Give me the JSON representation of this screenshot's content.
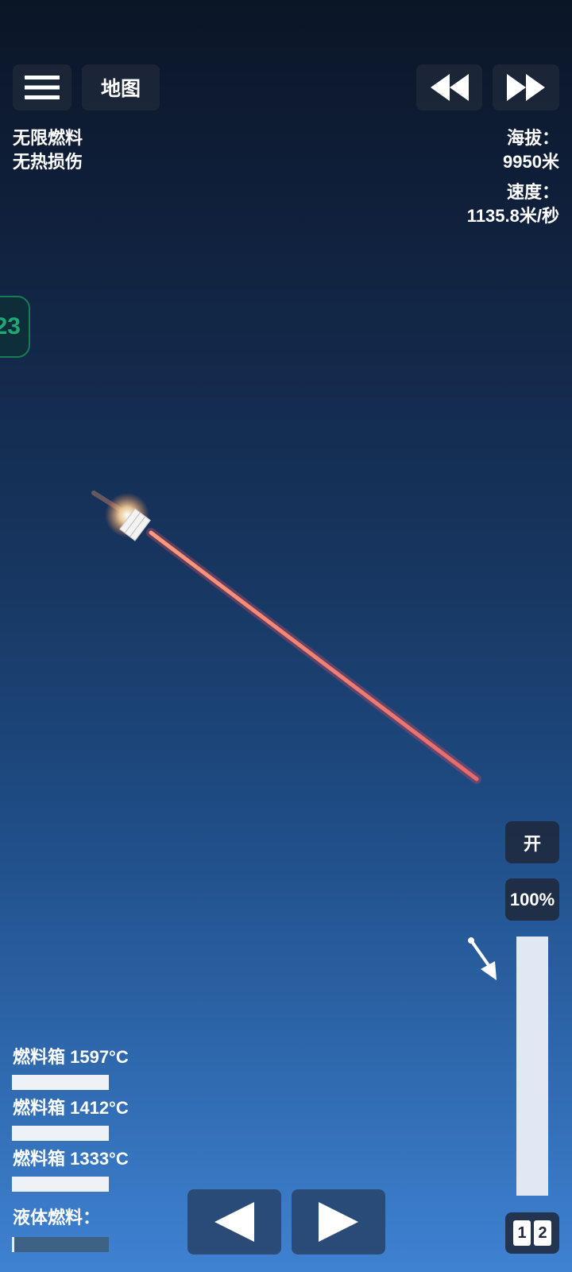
{
  "toolbar": {
    "menu_icon": "hamburger-menu-icon",
    "map_label": "地图",
    "rewind_icon": "rewind-icon",
    "fast_forward_icon": "fast-forward-icon"
  },
  "cheats": {
    "line1": "无限燃料",
    "line2": "无热损伤"
  },
  "telemetry": {
    "altitude_label": "海拔：",
    "altitude_value": "9950米",
    "speed_label": "速度：",
    "speed_value": "1135.8米/秒"
  },
  "stage_tab": {
    "label": "23"
  },
  "engine": {
    "toggle_label": "开",
    "throttle_label": "100%",
    "throttle_level": 1.0
  },
  "tanks": [
    {
      "label": "燃料箱 1597°C"
    },
    {
      "label": "燃料箱 1412°C"
    },
    {
      "label": "燃料箱 1333°C"
    }
  ],
  "liquid_fuel": {
    "label": "液体燃料："
  },
  "controls": {
    "left_icon": "triangle-left-icon",
    "right_icon": "triangle-right-icon",
    "page_1": "1",
    "page_2": "2"
  },
  "colors": {
    "panel": "#1e283a",
    "trail": "#f07a6a",
    "stage_green": "#1fa874"
  }
}
